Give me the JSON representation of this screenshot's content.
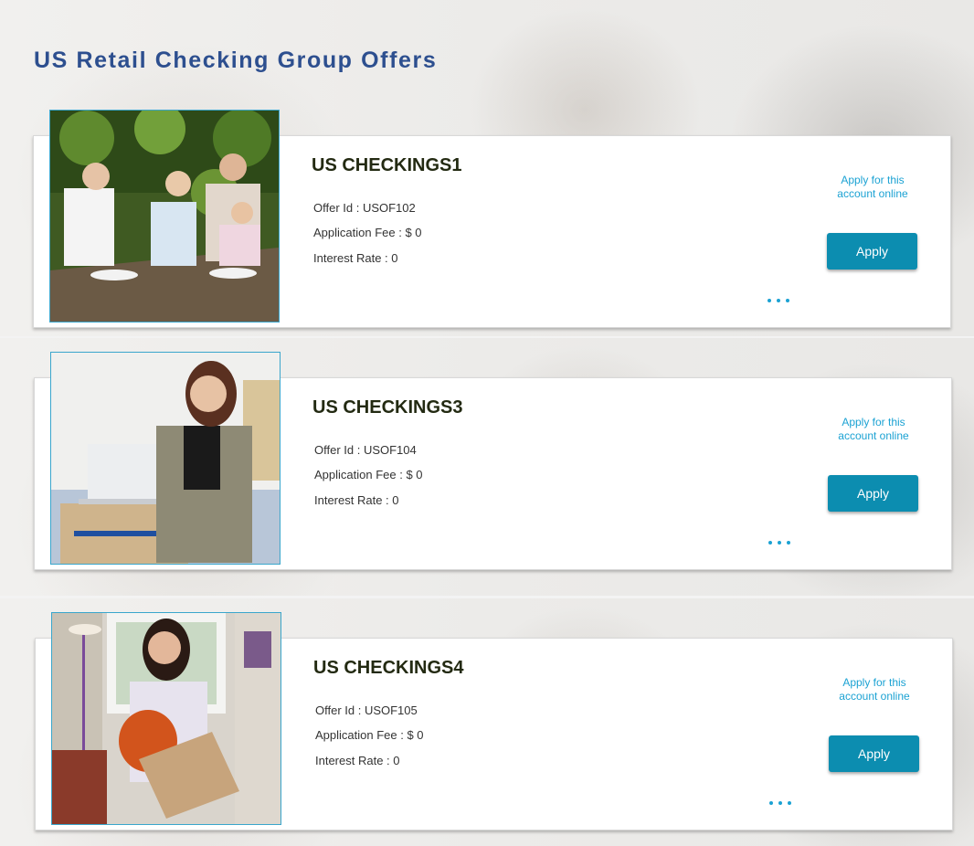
{
  "page": {
    "title": "US Retail Checking Group Offers"
  },
  "offers": [
    {
      "name": "US CHECKINGS1",
      "offer_id_label": "Offer Id : USOF102",
      "application_fee_label": "Application Fee : $ 0",
      "interest_rate_label": "Interest Rate : 0",
      "apply_online_text": "Apply for this account online",
      "apply_label": "Apply",
      "more_icon": "more-dots-icon",
      "photo": "family-dining-outdoors"
    },
    {
      "name": "US CHECKINGS3",
      "offer_id_label": "Offer Id : USOF104",
      "application_fee_label": "Application Fee : $ 0",
      "interest_rate_label": "Interest Rate : 0",
      "apply_online_text": "Apply for this account online",
      "apply_label": "Apply",
      "more_icon": "more-dots-icon",
      "photo": "businesswoman-at-laptop"
    },
    {
      "name": "US CHECKINGS4",
      "offer_id_label": "Offer Id : USOF105",
      "application_fee_label": "Application Fee : $ 0",
      "interest_rate_label": "Interest Rate : 0",
      "apply_online_text": "Apply for this account online",
      "apply_label": "Apply",
      "more_icon": "more-dots-icon",
      "photo": "woman-carrying-moving-box"
    }
  ],
  "colors": {
    "title": "#2d4f8f",
    "accent": "#1ba2d3",
    "button": "#0c8db0",
    "offer_name": "#232a12"
  }
}
